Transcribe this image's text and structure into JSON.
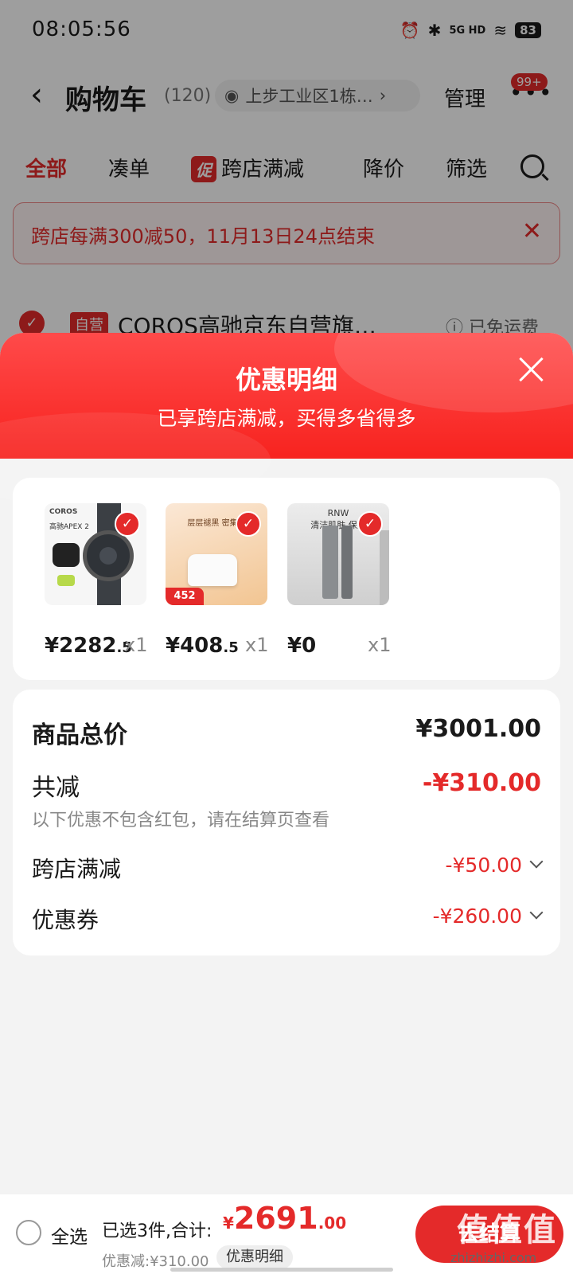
{
  "status_bar": {
    "time": "08:05:56",
    "network": "5G HD",
    "battery": "83"
  },
  "nav": {
    "title": "购物车",
    "count": "(120)",
    "address": "上步工业区1栋…",
    "manage": "管理",
    "more_badge": "99+"
  },
  "tabs": [
    {
      "label": "全部",
      "active": true
    },
    {
      "label": "凑单"
    },
    {
      "label": "跨店满减",
      "tag": "促"
    },
    {
      "label": "降价"
    },
    {
      "label": "筛选"
    }
  ],
  "banner": {
    "text": "跨店每满300减50，11月13日24点结束"
  },
  "store": {
    "tag": "自营",
    "name": "COROS高驰京东自营旗…",
    "shipping": "已免运费"
  },
  "sheet": {
    "title": "优惠明细",
    "subtitle": "已享跨店满减，买得多省得多",
    "products": [
      {
        "price_int": "¥2282",
        "price_dec": ".5",
        "qty": "x1",
        "image_text": "高驰APEX 2",
        "brand": "COROS"
      },
      {
        "price_int": "¥408",
        "price_dec": ".5",
        "qty": "x1",
        "image_text": "层层褪黑 密集淡",
        "badge": "452"
      },
      {
        "price_int": "¥0",
        "price_dec": "",
        "qty": "x1",
        "image_text": "清洁肌肤 保湿",
        "brand": "RNW"
      }
    ],
    "summary": {
      "total_label": "商品总价",
      "total_value": "¥3001.00",
      "reduce_label": "共减",
      "reduce_value": "-¥310.00",
      "note": "以下优惠不包含红包，请在结算页查看",
      "items": [
        {
          "label": "跨店满减",
          "value": "-¥50.00"
        },
        {
          "label": "优惠券",
          "value": "-¥260.00"
        }
      ]
    }
  },
  "bottom": {
    "select_all": "全选",
    "chosen": "已选3件,合计:",
    "currency": "¥",
    "total_int": "2691",
    "total_dec": ".00",
    "discount": "优惠减:¥310.00",
    "detail_button": "优惠明细",
    "checkout": "去结算",
    "watermark": "值值值",
    "watermark_url": "zhizhizhi.com"
  },
  "colors": {
    "accent": "#e42a2a",
    "sheet_header": "#f7231f"
  }
}
